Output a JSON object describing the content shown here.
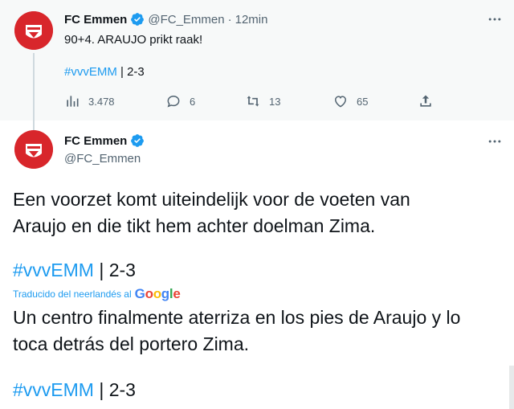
{
  "tweet1": {
    "name": "FC Emmen",
    "handle": "@FC_Emmen",
    "separator": "·",
    "time": "12min",
    "text": "90+4. ARAUJO prikt raak!",
    "hashtag": "#vvvEMM",
    "score": " | 2-3",
    "actions": {
      "views": "3.478",
      "replies": "6",
      "retweets": "13",
      "likes": "65"
    }
  },
  "tweet2": {
    "name": "FC Emmen",
    "handle": "@FC_Emmen",
    "text_line1": "Een voorzet komt uiteindelijk voor de voeten van",
    "text_line2": "Araujo en die tikt hem achter doelman Zima.",
    "hashtag": "#vvvEMM",
    "score": " | 2-3",
    "translated_by": "Traducido del neerlandés al",
    "google": "Google",
    "translation_line1": "Un centro finalmente aterriza en los pies de Araujo y lo",
    "translation_line2": "toca detrás del portero Zima.",
    "hashtag2": "#vvvEMM",
    "score2": " | 2-3"
  },
  "colors": {
    "link": "#1d9bf0",
    "verified": "#1d9bf0",
    "secondary_text": "#536471",
    "club_red": "#d8262b"
  },
  "icons": {
    "avatar": "fc-emmen-crest",
    "verified": "verified-badge-icon",
    "more": "more-dots-icon",
    "views": "bar-chart-icon",
    "reply": "reply-bubble-icon",
    "retweet": "retweet-icon",
    "like": "heart-icon",
    "share": "share-upload-icon"
  }
}
